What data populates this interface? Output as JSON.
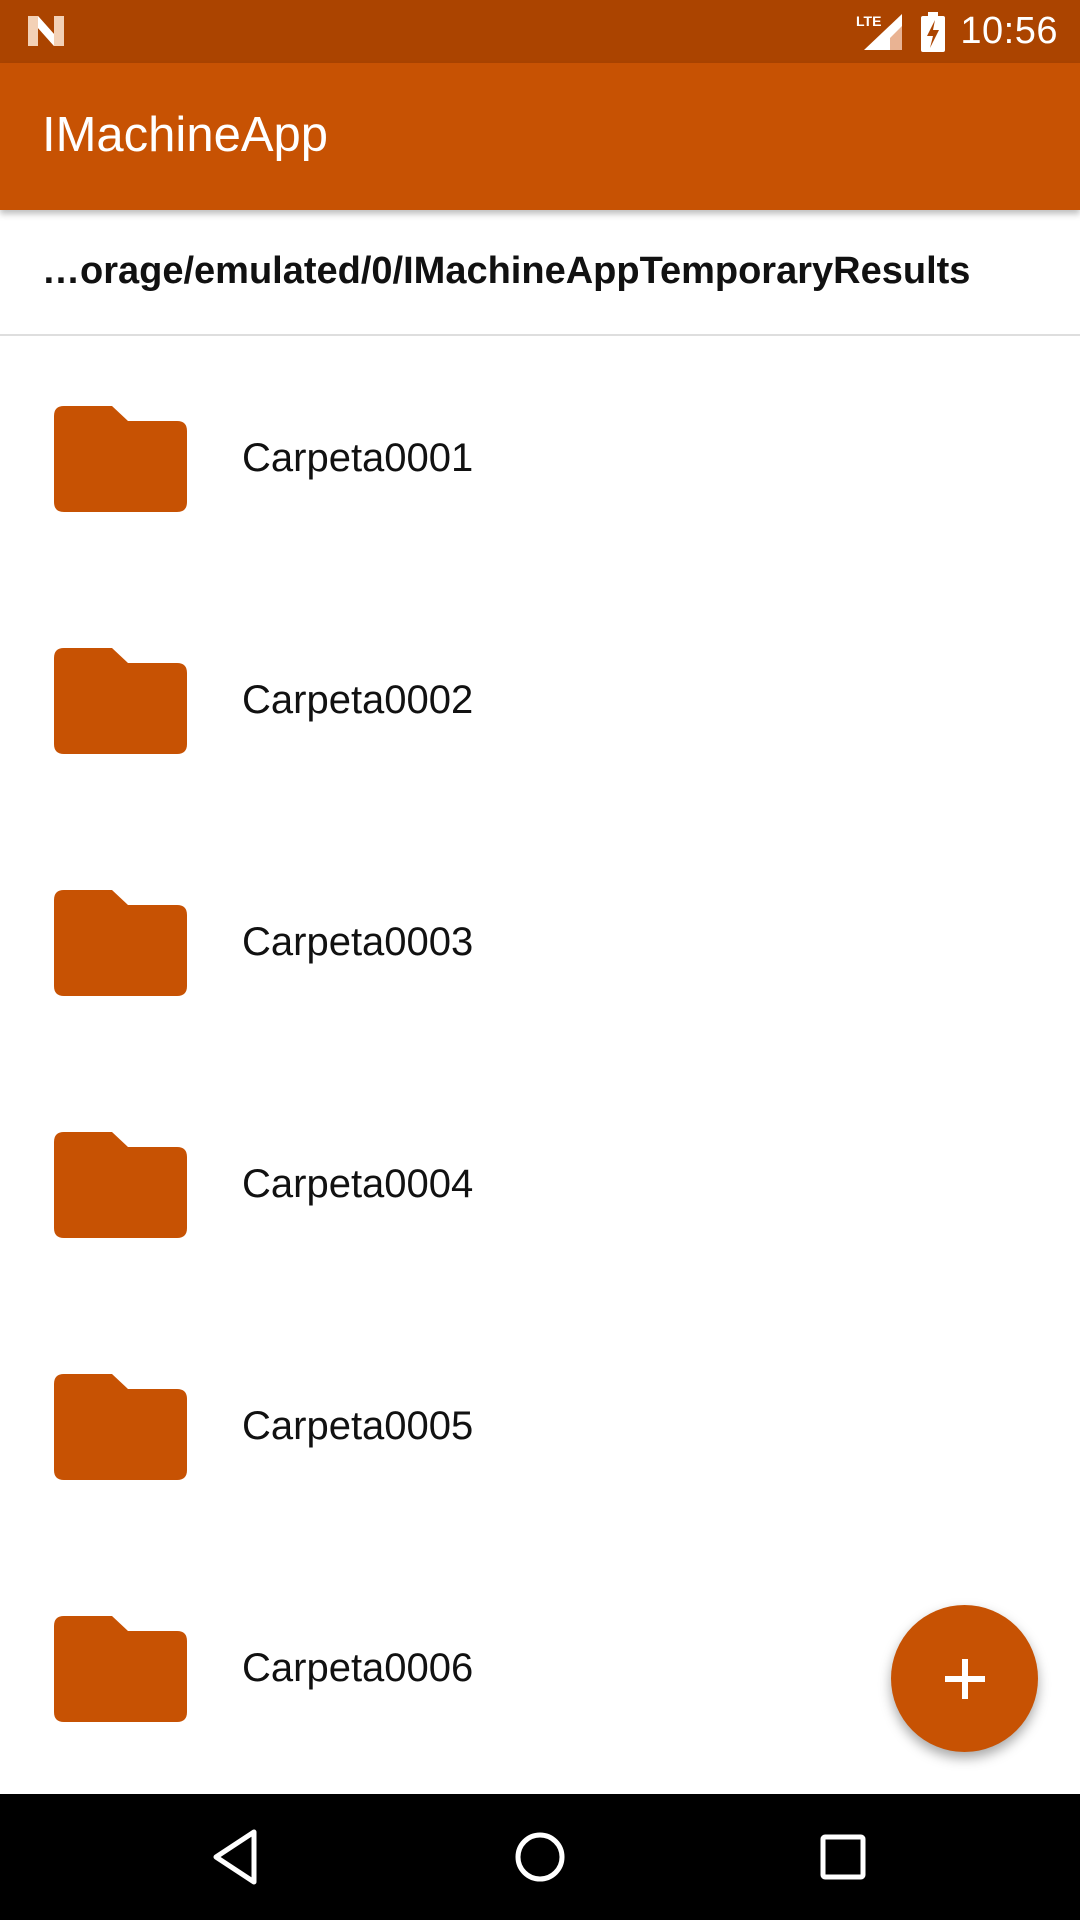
{
  "status_bar": {
    "time": "10:56",
    "network_label": "LTE",
    "icons": [
      "notification-n-icon",
      "signal-icon",
      "battery-charging-icon"
    ]
  },
  "app_bar": {
    "title": "IMachineApp"
  },
  "path_bar": {
    "path": "…orage/emulated/0/IMachineAppTemporaryResults"
  },
  "folders": [
    {
      "label": "Carpeta0001",
      "icon": "folder-icon"
    },
    {
      "label": "Carpeta0002",
      "icon": "folder-icon"
    },
    {
      "label": "Carpeta0003",
      "icon": "folder-icon"
    },
    {
      "label": "Carpeta0004",
      "icon": "folder-icon"
    },
    {
      "label": "Carpeta0005",
      "icon": "folder-icon"
    },
    {
      "label": "Carpeta0006",
      "icon": "folder-icon"
    }
  ],
  "fab": {
    "icon": "plus-icon"
  },
  "nav_bar": {
    "icons": [
      "back-icon",
      "home-icon",
      "recents-icon"
    ]
  },
  "colors": {
    "status_bar": "#ab4400",
    "primary": "#c75203",
    "text": "#111111",
    "nav_bar": "#000000"
  }
}
